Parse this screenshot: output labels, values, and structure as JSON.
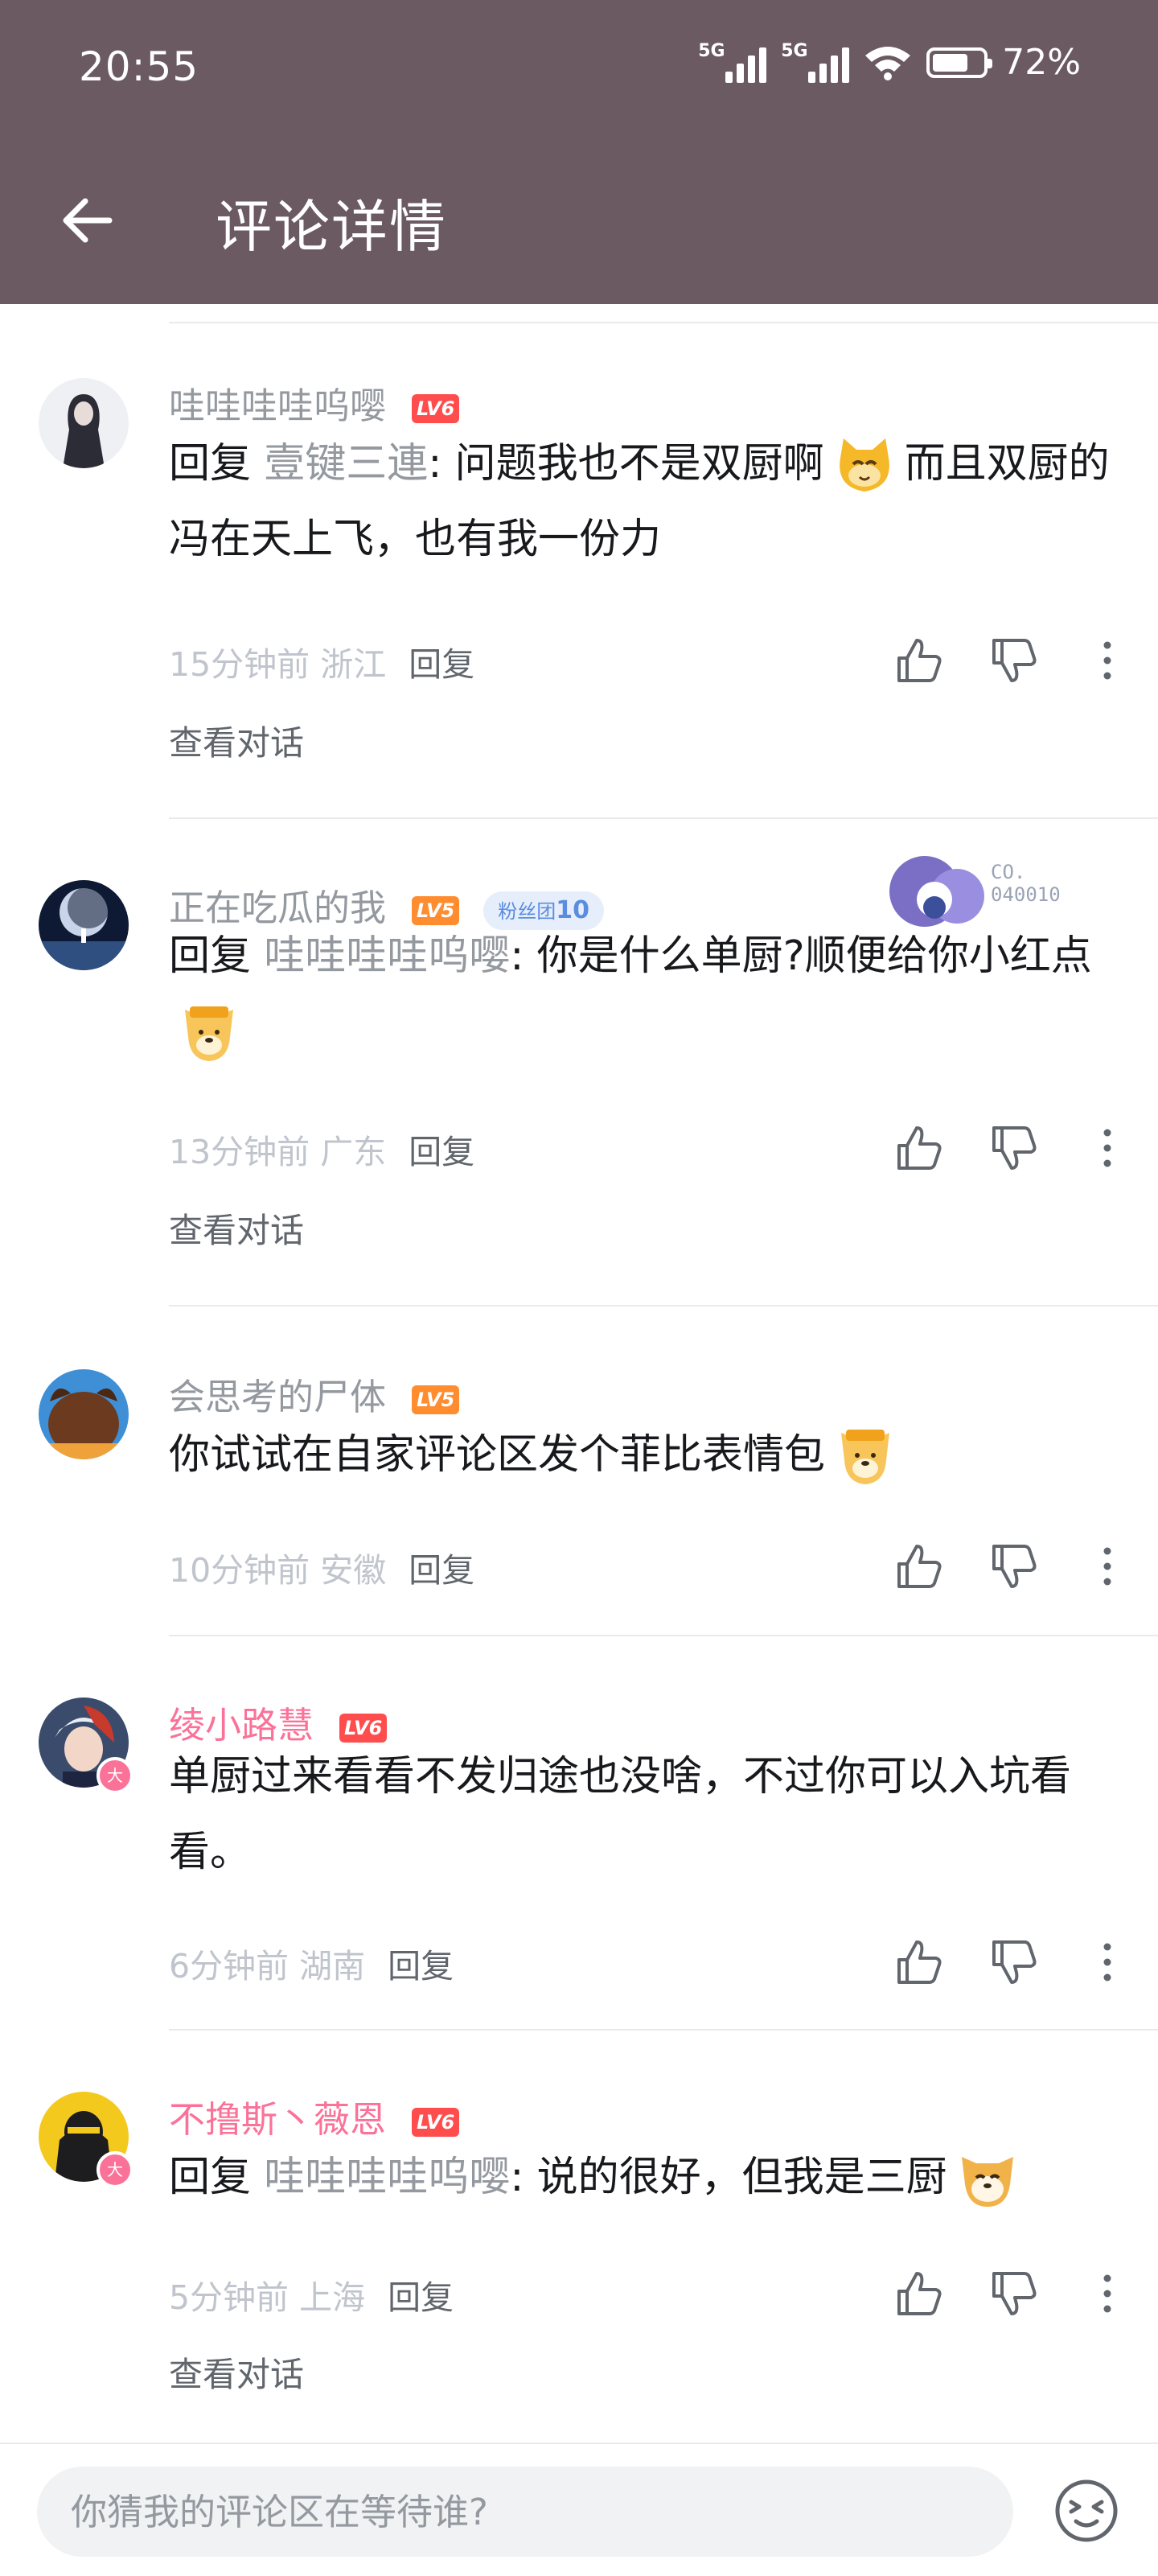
{
  "status_bar": {
    "time": "20:55",
    "net1": "5G",
    "net2": "5G",
    "battery": "72%",
    "battery_level": 0.72
  },
  "header": {
    "title": "评论详情"
  },
  "comments": [
    {
      "username": "哇哇哇哇呜嘤",
      "level": "LV6",
      "reply_prefix": "回复 ",
      "reply_target": "壹键三連",
      "text_a": ": 问题我也不是双厨啊",
      "text_b": "而且双厨的冯在天上飞，也有我一份力",
      "time": "15分钟前",
      "location": "浙江",
      "reply_label": "回复",
      "view_dialog": "查看对话"
    },
    {
      "username": "正在吃瓜的我",
      "level": "LV5",
      "fan_label": "粉丝团",
      "fan_level": "10",
      "deco_text_1": "CO.",
      "deco_text_2": "040010",
      "reply_prefix": "回复 ",
      "reply_target": "哇哇哇哇呜嘤",
      "text_a": ": 你是什么单厨?顺便给你小红点",
      "time": "13分钟前",
      "location": "广东",
      "reply_label": "回复",
      "view_dialog": "查看对话"
    },
    {
      "username": "会思考的尸体",
      "level": "LV5",
      "text_a": "你试试在自家评论区发个菲比表情包",
      "time": "10分钟前",
      "location": "安徽",
      "reply_label": "回复"
    },
    {
      "username": "绫小路慧",
      "level": "LV6",
      "big_member": "大",
      "text_a": "单厨过来看看不发归途也没啥，不过你可以入坑看看。",
      "time": "6分钟前",
      "location": "湖南",
      "reply_label": "回复"
    },
    {
      "username": "不撸斯丶薇恩",
      "level": "LV6",
      "big_member": "大",
      "reply_prefix": "回复 ",
      "reply_target": "哇哇哇哇呜嘤",
      "text_a": ": 说的很好，但我是三厨",
      "time": "5分钟前",
      "location": "上海",
      "reply_label": "回复",
      "view_dialog": "查看对话"
    }
  ],
  "input": {
    "placeholder": "你猜我的评论区在等待谁?"
  },
  "icons": [
    "back-arrow-icon",
    "thumb-up-icon",
    "thumb-down-icon",
    "more-vertical-icon",
    "emoji-icon",
    "signal-icon",
    "wifi-icon",
    "battery-icon"
  ],
  "colors": {
    "header_bg": "#6b5a62",
    "vip_pink": "#fb7299",
    "lv6": "#ff4d4d",
    "lv5": "#ff8c2e",
    "meta_gray": "#9499a0"
  }
}
